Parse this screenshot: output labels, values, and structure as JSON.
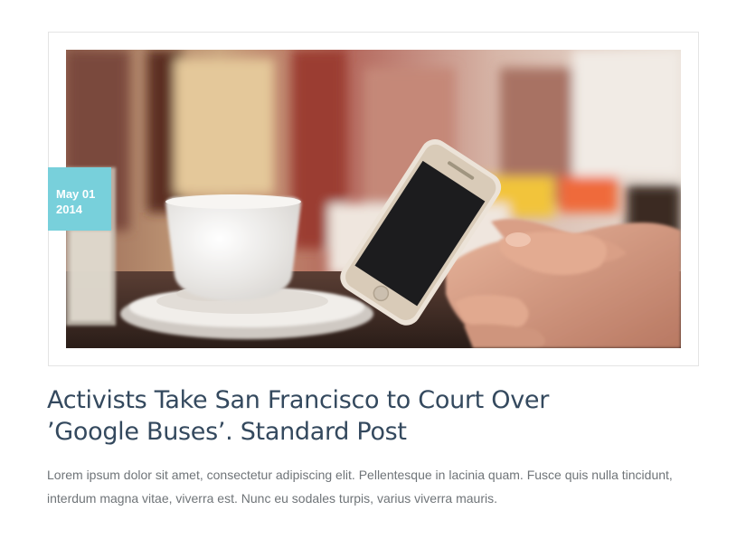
{
  "post": {
    "date": {
      "month_day": "May 01",
      "year": "2014"
    },
    "title": "Activists Take San Francisco to Court Over ’Google Buses’. Standard Post",
    "excerpt": "Lorem ipsum dolor sit amet, consectetur adipiscing elit. Pellentesque in lacinia quam. Fusce quis nulla tincidunt, interdum magna vitae, viverra est. Nunc eu sodales turpis, varius viverra mauris.",
    "image_subject": "hand-holding-smartphone-in-cafe"
  },
  "colors": {
    "date_badge": "#78d0db",
    "title": "#34495e",
    "excerpt": "#6f7478",
    "frame_border": "#e4e4e4"
  }
}
